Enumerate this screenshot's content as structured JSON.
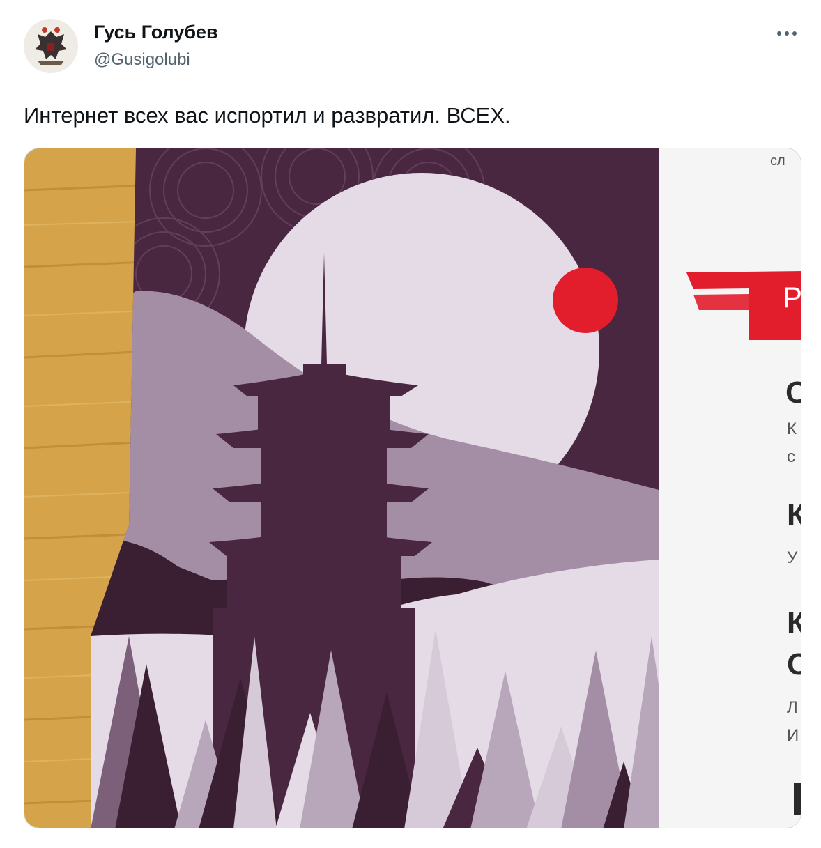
{
  "author": {
    "display_name": "Гусь Голубев",
    "handle": "@Gusigolubi"
  },
  "tweet": {
    "text": "Интернет всех вас испортил и развратил. ВСЕХ."
  },
  "icons": {
    "more": "more-options-icon"
  },
  "media": {
    "description_visible_text": [
      "сл",
      "Р",
      "С",
      "К",
      "с",
      "К",
      "У",
      "К",
      "С",
      "Л",
      "И"
    ]
  },
  "colors": {
    "text_primary": "#0f1419",
    "text_secondary": "#536471",
    "poster_dark": "#4a2740",
    "poster_mid": "#a48ea6",
    "poster_light": "#e4dbe6",
    "sun_red": "#e21d2c",
    "wood": "#d5a44a"
  }
}
